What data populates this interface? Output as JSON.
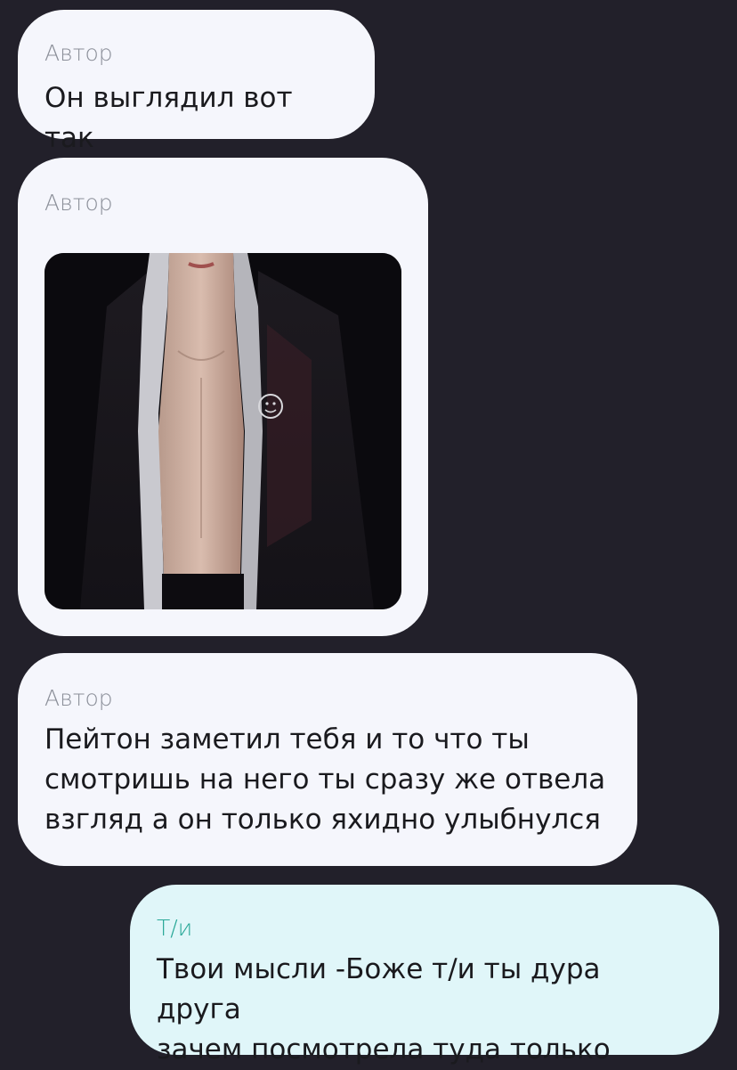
{
  "messages": [
    {
      "sender": "Автор",
      "text": "Он выглядил вот так"
    },
    {
      "sender": "Автор",
      "image": "photo-shirtless-man-in-open-black-hoodie"
    },
    {
      "sender": "Автор",
      "lines": [
        "Пейтон заметил тебя и то что ты",
        "смотришь на него ты сразу же отвела",
        "взгляд а он только яхидно улыбнулся"
      ]
    },
    {
      "sender": "Т/и",
      "lines": [
        "Твои мысли -Боже т/и ты дура друга",
        "зачем посмотрела туда только"
      ]
    }
  ],
  "colors": {
    "background": "#22202a",
    "incoming_bubble": "#f5f6fc",
    "outgoing_bubble": "#e0f6f9",
    "incoming_sender": "#8b8f99",
    "outgoing_sender": "#29a898"
  }
}
